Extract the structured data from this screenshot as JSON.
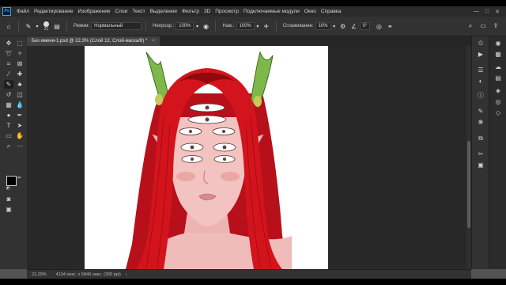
{
  "app": {
    "logo_text": "Ps"
  },
  "menu": [
    "Файл",
    "Редактирование",
    "Изображение",
    "Слои",
    "Текст",
    "Выделение",
    "Фильтр",
    "3D",
    "Просмотр",
    "Подключаемые модули",
    "Окно",
    "Справка"
  ],
  "window_controls": [
    "—",
    "□",
    "✕"
  ],
  "options": {
    "brush_size": "21",
    "mode_label": "Режим:",
    "mode_value": "Нормальный",
    "opacity_label": "Непрозр.:",
    "opacity_value": "100%",
    "pressure_label": "Наж.:",
    "pressure_value": "100%",
    "smoothing_label": "Сглаживание:",
    "smoothing_value": "10%",
    "angle_value": "0°"
  },
  "document_tab": {
    "title": "Без имени-1.psd @ 22,3% (Слой 12, Слой-маска/8) *",
    "close": "×"
  },
  "statusbar": {
    "zoom": "22,29%",
    "info": "4134 пикс. x 5846 пикс. (300 ppi)",
    "arrow": "›"
  },
  "colors": {
    "hair": "#d4141c",
    "hair_dark": "#8e0a10",
    "skin": "#f2c3c0",
    "horn": "#7fb84a",
    "horn_tip": "#c9c95a",
    "foreground": "#000000",
    "background": "#ffffff"
  }
}
